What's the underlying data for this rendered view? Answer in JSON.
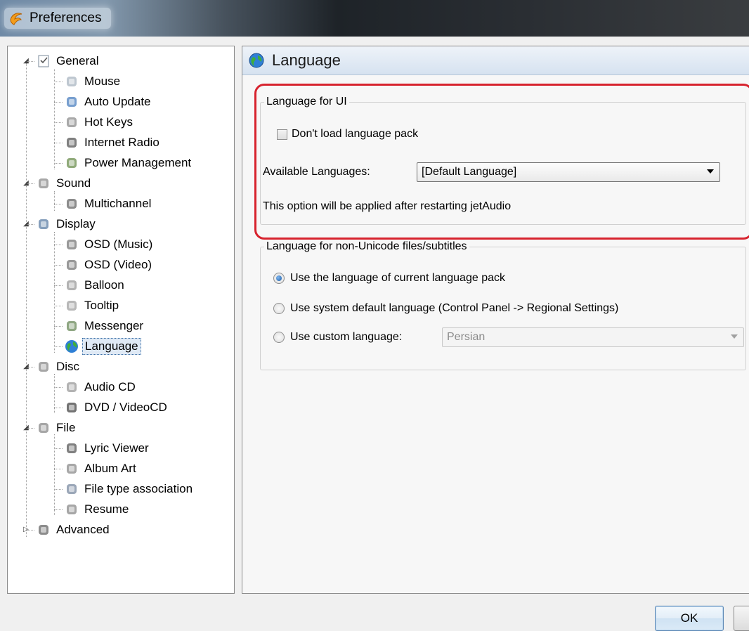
{
  "window": {
    "title": "Preferences"
  },
  "tree": {
    "items": [
      {
        "label": "General",
        "level": 0,
        "expander": "expanded",
        "icon": "checklist-icon"
      },
      {
        "label": "Mouse",
        "level": 1,
        "icon": "mouse-icon"
      },
      {
        "label": "Auto Update",
        "level": 1,
        "icon": "globe-update-icon"
      },
      {
        "label": "Hot Keys",
        "level": 1,
        "icon": "keyboard-icon"
      },
      {
        "label": "Internet Radio",
        "level": 1,
        "icon": "radio-icon"
      },
      {
        "label": "Power Management",
        "level": 1,
        "icon": "power-icon"
      },
      {
        "label": "Sound",
        "level": 0,
        "expander": "expanded",
        "icon": "speaker-icon"
      },
      {
        "label": "Multichannel",
        "level": 1,
        "icon": "multichannel-icon"
      },
      {
        "label": "Display",
        "level": 0,
        "expander": "expanded",
        "icon": "display-icon"
      },
      {
        "label": "OSD (Music)",
        "level": 1,
        "icon": "osd-icon"
      },
      {
        "label": "OSD (Video)",
        "level": 1,
        "icon": "osd-icon"
      },
      {
        "label": "Balloon",
        "level": 1,
        "icon": "balloon-icon"
      },
      {
        "label": "Tooltip",
        "level": 1,
        "icon": "tooltip-icon"
      },
      {
        "label": "Messenger",
        "level": 1,
        "icon": "messenger-icon"
      },
      {
        "label": "Language",
        "level": 1,
        "icon": "globe-icon",
        "selected": true
      },
      {
        "label": "Disc",
        "level": 0,
        "expander": "expanded",
        "icon": "disc-icon"
      },
      {
        "label": "Audio CD",
        "level": 1,
        "icon": "cd-icon"
      },
      {
        "label": "DVD / VideoCD",
        "level": 1,
        "icon": "dvd-icon"
      },
      {
        "label": "File",
        "level": 0,
        "expander": "expanded",
        "icon": "file-icon"
      },
      {
        "label": "Lyric Viewer",
        "level": 1,
        "icon": "microphone-icon"
      },
      {
        "label": "Album Art",
        "level": 1,
        "icon": "album-art-icon"
      },
      {
        "label": "File type association",
        "level": 1,
        "icon": "file-association-icon"
      },
      {
        "label": "Resume",
        "level": 1,
        "icon": "resume-icon"
      },
      {
        "label": "Advanced",
        "level": 0,
        "expander": "collapsed",
        "icon": "advanced-icon"
      }
    ]
  },
  "panel": {
    "title": "Language",
    "ui_group": {
      "legend": "Language for UI",
      "dont_load_label": "Don't load language pack",
      "dont_load_checked": false,
      "available_label": "Available Languages:",
      "available_value": "[Default Language]",
      "note": "This option will be applied after restarting jetAudio"
    },
    "nonunicode_group": {
      "legend": "Language for non-Unicode files/subtitles",
      "option_current": "Use the language of current language pack",
      "option_system": "Use system default language (Control Panel -> Regional Settings)",
      "option_custom": "Use custom language:",
      "selected_option": "current",
      "custom_value": "Persian"
    }
  },
  "buttons": {
    "ok": "OK"
  },
  "colors": {
    "highlight": "#d7232e",
    "selection": "#dfe9f5"
  }
}
